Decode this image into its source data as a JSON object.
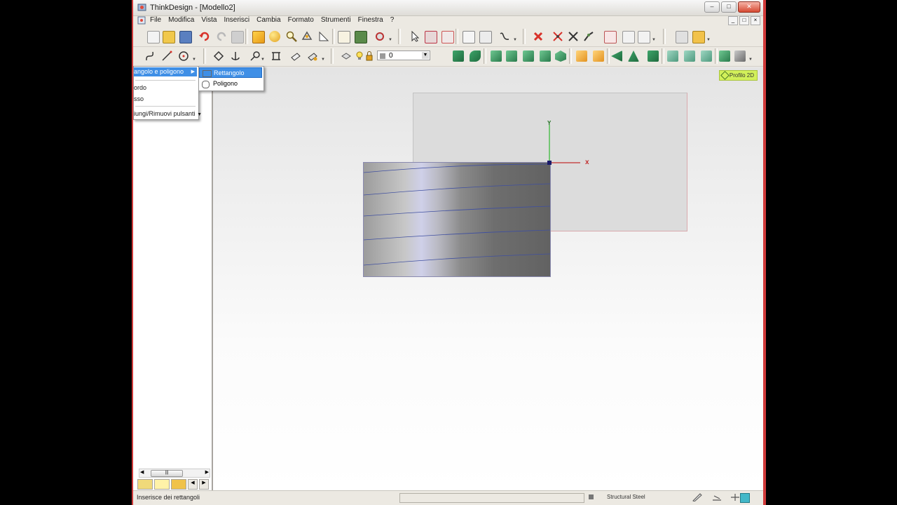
{
  "window": {
    "title": "ThinkDesign  - [Modello2]"
  },
  "menubar": {
    "items": [
      "File",
      "Modifica",
      "Vista",
      "Inserisci",
      "Cambia",
      "Formato",
      "Strumenti",
      "Finestra",
      "?"
    ]
  },
  "toolbar": {
    "layer_value": "0"
  },
  "flyout": {
    "item_polygon": "angolo e poligono",
    "item_raccordo": "ordo",
    "item_asso": "sso",
    "item_buttons": "iungi/Rimuovi pulsanti"
  },
  "submenu": {
    "items": [
      "Rettangolo",
      "Poligono"
    ]
  },
  "viewport": {
    "profile_button": "Profilo 2D",
    "axis_y_label": "Y",
    "axis_x_label": "x"
  },
  "status": {
    "text": "Inserisce dei rettangoli",
    "material": "Structural Steel"
  },
  "colors": {
    "accent": "#3f8fe6",
    "axis_x": "#c22f2f",
    "axis_y": "#2fb82f",
    "profile_badge": "#d2f05a"
  }
}
